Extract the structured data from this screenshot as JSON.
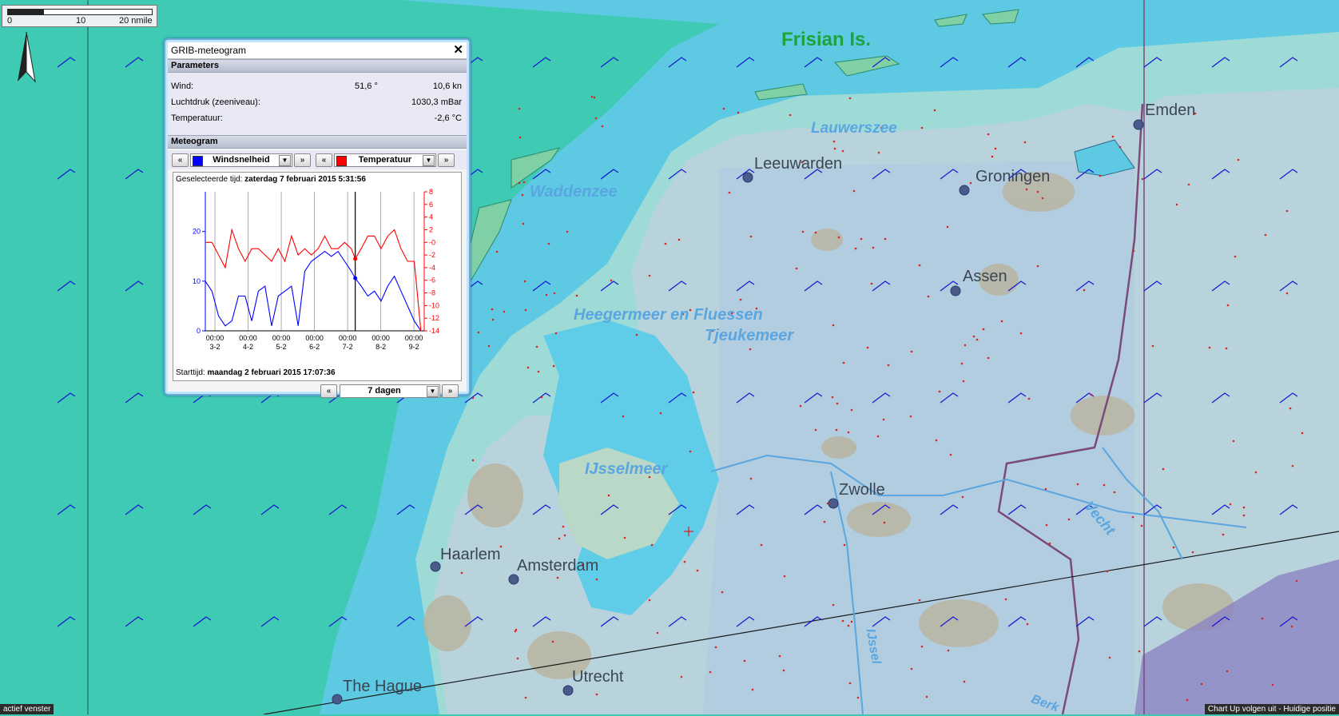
{
  "map": {
    "places": [
      {
        "name": "Leeuwarden"
      },
      {
        "name": "Groningen"
      },
      {
        "name": "Emden"
      },
      {
        "name": "Assen"
      },
      {
        "name": "Zwolle"
      },
      {
        "name": "Haarlem"
      },
      {
        "name": "Amsterdam"
      },
      {
        "name": "Utrecht"
      },
      {
        "name": "The Hague"
      }
    ],
    "water_labels": [
      "Waddenzee",
      "Lauwerszee",
      "Heegermeer en Fluessen",
      "Tjeukemeer",
      "IJsselmeer"
    ],
    "region_label": "Frisian Is.",
    "river_labels": [
      "Vecht",
      "IJssel",
      "Berk"
    ]
  },
  "scalebar": {
    "labels": [
      "0",
      "10",
      "20 nmile"
    ]
  },
  "meteogram": {
    "title": "GRIB-meteogram",
    "parameters_header": "Parameters",
    "params": [
      {
        "label": "Wind:",
        "value": "51,6 °",
        "unit": "10,6 kn"
      },
      {
        "label": "Luchtdruk (zeeniveau):",
        "value": "",
        "unit": "1030,3 mBar"
      },
      {
        "label": "Temperatuur:",
        "value": "",
        "unit": "-2,6 °C"
      }
    ],
    "meteogram_header": "Meteogram",
    "left_series": {
      "name": "Windsnelheid",
      "color": "#0000ff"
    },
    "right_series": {
      "name": "Temperatuur",
      "color": "#ff0000"
    },
    "selected_time_label": "Geselecteerde tijd:",
    "selected_time": "zaterdag 7 februari 2015 5:31:56",
    "start_time_label": "Starttijd:",
    "start_time": "maandag 2 februari 2015 17:07:36",
    "period": "7 dagen",
    "prev": "«",
    "next": "»"
  },
  "chart_data": {
    "type": "line",
    "x_tick_labels": [
      [
        "00:00",
        "3-2"
      ],
      [
        "00:00",
        "4-2"
      ],
      [
        "00:00",
        "5-2"
      ],
      [
        "00:00",
        "6-2"
      ],
      [
        "00:00",
        "7-2"
      ],
      [
        "00:00",
        "8-2"
      ],
      [
        "00:00",
        "9-2"
      ]
    ],
    "x_tick_days": [
      0.29,
      1.29,
      2.29,
      3.29,
      4.29,
      5.29,
      6.29
    ],
    "selected_day": 4.52,
    "xlim": [
      0,
      6.6
    ],
    "left_axis": {
      "ylim": [
        0,
        28
      ],
      "ticks": [
        0,
        10,
        20
      ],
      "color": "#0000ff"
    },
    "right_axis": {
      "ylim": [
        -14,
        8
      ],
      "ticks": [
        8,
        6,
        4,
        2,
        0,
        -2,
        -4,
        -6,
        -8,
        -10,
        -12,
        -14
      ],
      "tick_labels": [
        "8",
        "6",
        "4",
        "2",
        "-0",
        "-2",
        "-4",
        "-6",
        "-8",
        "-10",
        "-12",
        "-14"
      ],
      "color": "#ff0000"
    },
    "series": [
      {
        "name": "Windsnelheid",
        "axis": "left",
        "color": "#0000ff",
        "x": [
          0,
          0.2,
          0.4,
          0.6,
          0.8,
          1.0,
          1.2,
          1.4,
          1.6,
          1.8,
          2.0,
          2.2,
          2.4,
          2.6,
          2.8,
          3.0,
          3.2,
          3.4,
          3.6,
          3.8,
          4.0,
          4.2,
          4.4,
          4.52,
          4.7,
          4.9,
          5.1,
          5.3,
          5.5,
          5.7,
          5.9,
          6.1,
          6.3,
          6.5
        ],
        "y": [
          10,
          8,
          3,
          1,
          2,
          7,
          7,
          2,
          8,
          9,
          1,
          7,
          8,
          9,
          1,
          12,
          14,
          15,
          16,
          15,
          16,
          14,
          12,
          10.6,
          9,
          7,
          8,
          6,
          9,
          11,
          8,
          5,
          2,
          0
        ]
      },
      {
        "name": "Temperatuur",
        "axis": "right",
        "color": "#ff0000",
        "x": [
          0,
          0.2,
          0.4,
          0.6,
          0.8,
          1.0,
          1.2,
          1.4,
          1.6,
          1.8,
          2.0,
          2.2,
          2.4,
          2.6,
          2.8,
          3.0,
          3.2,
          3.4,
          3.6,
          3.8,
          4.0,
          4.2,
          4.4,
          4.52,
          4.7,
          4.9,
          5.1,
          5.3,
          5.5,
          5.7,
          5.9,
          6.1,
          6.3,
          6.5
        ],
        "y": [
          0,
          0,
          -2,
          -4,
          2,
          -1,
          -3,
          -1,
          -1,
          -2,
          -3,
          -1,
          -3,
          1,
          -2,
          -1,
          -2,
          -1,
          1,
          -1,
          -1,
          0,
          -1,
          -2.6,
          -1,
          1,
          1,
          -1,
          1,
          2,
          -1,
          -3,
          -3,
          -14
        ]
      }
    ]
  },
  "status": {
    "left": "actief venster",
    "right": "Chart Up volgen uit - Huidige positie"
  }
}
